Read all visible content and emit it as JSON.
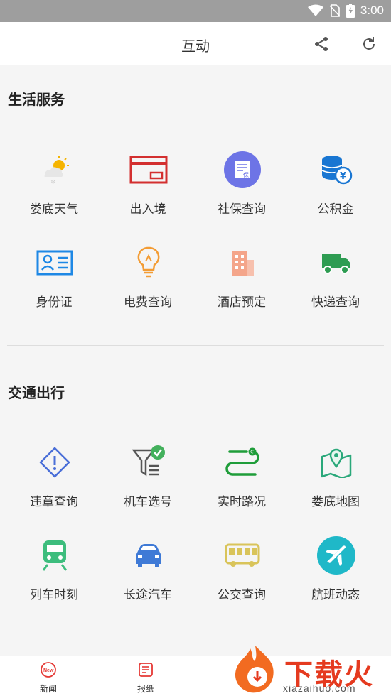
{
  "status_bar": {
    "time": "3:00",
    "icons": [
      "wifi-icon",
      "no-sim-icon",
      "battery-icon"
    ]
  },
  "app_bar": {
    "title": "互动",
    "actions": [
      "share-icon",
      "refresh-icon"
    ]
  },
  "sections": [
    {
      "title": "生活服务",
      "items": [
        {
          "label": "娄底天气",
          "icon": "weather-icon"
        },
        {
          "label": "出入境",
          "icon": "card-icon"
        },
        {
          "label": "社保查询",
          "icon": "social-security-icon"
        },
        {
          "label": "公积金",
          "icon": "coins-icon"
        },
        {
          "label": "身份证",
          "icon": "id-card-icon"
        },
        {
          "label": "电费查询",
          "icon": "bulb-icon"
        },
        {
          "label": "酒店预定",
          "icon": "hotel-icon"
        },
        {
          "label": "快递查询",
          "icon": "truck-icon"
        }
      ]
    },
    {
      "title": "交通出行",
      "items": [
        {
          "label": "违章查询",
          "icon": "warning-icon"
        },
        {
          "label": "机车选号",
          "icon": "filter-check-icon"
        },
        {
          "label": "实时路况",
          "icon": "route-icon"
        },
        {
          "label": "娄底地图",
          "icon": "map-icon"
        },
        {
          "label": "列车时刻",
          "icon": "train-icon"
        },
        {
          "label": "长途汽车",
          "icon": "car-icon"
        },
        {
          "label": "公交查询",
          "icon": "bus-icon"
        },
        {
          "label": "航班动态",
          "icon": "plane-icon"
        }
      ]
    }
  ],
  "tab_bar": [
    {
      "label": "新闻",
      "icon": "news-icon",
      "badge": "New"
    },
    {
      "label": "报纸",
      "icon": "newspaper-icon"
    }
  ],
  "watermark": {
    "text": "下载火",
    "url": "xiazaihuo.com"
  },
  "colors": {
    "status_bar": "#9e9e9e",
    "background": "#f5f5f5",
    "accent_red": "#e53a1f"
  }
}
